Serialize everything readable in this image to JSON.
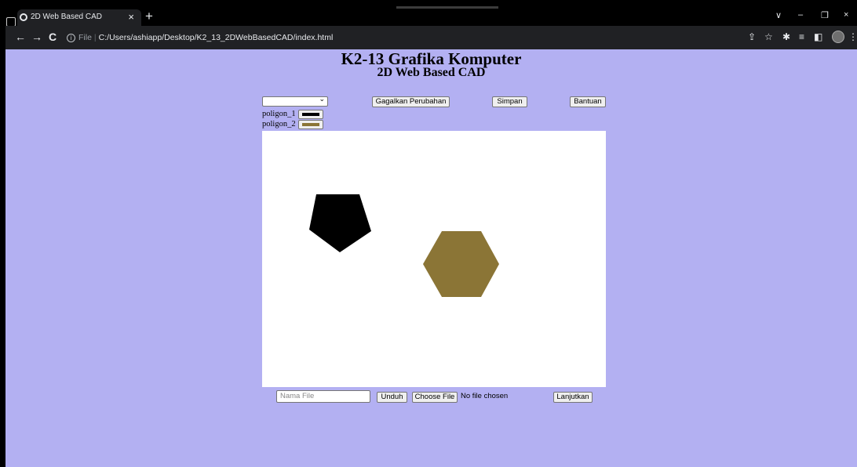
{
  "browser": {
    "tab_title": "2D Web Based CAD",
    "tab_close": "×",
    "new_tab": "+",
    "nav_back": "←",
    "nav_forward": "→",
    "nav_reload": "C",
    "url_info": "i",
    "url_protocol": "File",
    "url_separator": "|",
    "url": "C:/Users/ashiapp/Desktop/K2_13_2DWebBasedCAD/index.html",
    "win_chevron": "∨",
    "win_minimize": "–",
    "win_restore": "❐",
    "win_close": "×",
    "toolbar_share": "⇪",
    "toolbar_star": "☆",
    "toolbar_extensions": "✱",
    "toolbar_queue": "≡",
    "toolbar_sidepanel": "◧",
    "toolbar_menu": "⋮"
  },
  "page": {
    "title": "K2-13 Grafika Komputer",
    "subtitle": "2D Web Based CAD",
    "colors": {
      "background": "#b3b0f2",
      "canvas": "#ffffff"
    },
    "toolbar": {
      "select_value": "",
      "undo_label": "Gagalkan Perubahan",
      "save_label": "Simpan",
      "help_label": "Bantuan"
    },
    "polygons": [
      {
        "label": "poligon_1",
        "color": "#000000",
        "shape": "pentagon"
      },
      {
        "label": "poligon_2",
        "color": "#8b7536",
        "shape": "hexagon"
      }
    ],
    "footer": {
      "filename_placeholder": "Nama File",
      "download_label": "Unduh",
      "choose_file_label": "Choose File",
      "no_file_label": "No file chosen",
      "continue_label": "Lanjutkan"
    }
  }
}
